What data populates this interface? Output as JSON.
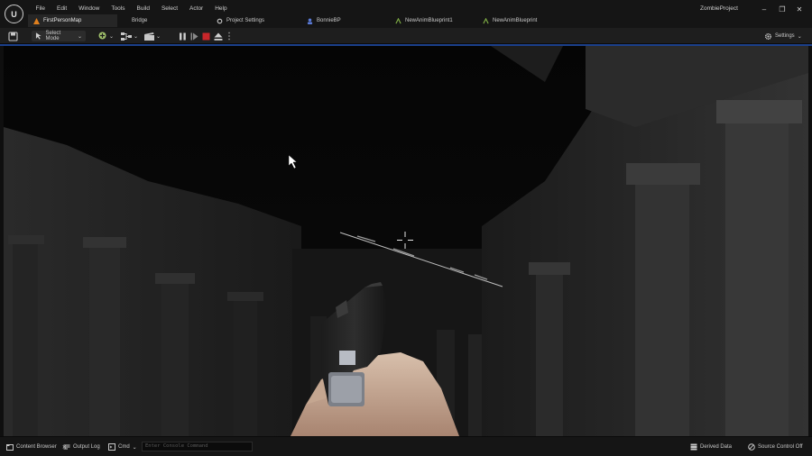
{
  "app": {
    "project_name": "ZombieProject"
  },
  "menu": [
    "File",
    "Edit",
    "Window",
    "Tools",
    "Build",
    "Select",
    "Actor",
    "Help"
  ],
  "tabs": [
    {
      "label": "FirstPersonMap",
      "icon": "level-icon",
      "active": true
    },
    {
      "label": "Bridge",
      "icon": "",
      "active": false
    },
    {
      "label": "Project Settings",
      "icon": "settings-icon",
      "active": false
    },
    {
      "label": "BonnieBP",
      "icon": "blueprint-icon",
      "active": false
    },
    {
      "label": "NewAnimBlueprint1",
      "icon": "anim-blueprint-icon",
      "active": false
    },
    {
      "label": "NewAnimBlueprint",
      "icon": "anim-blueprint-icon",
      "active": false
    }
  ],
  "toolbar": {
    "select_mode_label": "Select Mode",
    "settings_label": "Settings"
  },
  "statusbar": {
    "content_browser_label": "Content Browser",
    "output_log_label": "Output Log",
    "cmd_label": "Cmd",
    "console_placeholder": "Enter Console Command",
    "derived_data_label": "Derived Data",
    "source_control_label": "Source Control Off"
  },
  "colors": {
    "accent": "#1b3f8a",
    "stop": "#c8262a",
    "level_tab_icon": "#e0801e"
  }
}
